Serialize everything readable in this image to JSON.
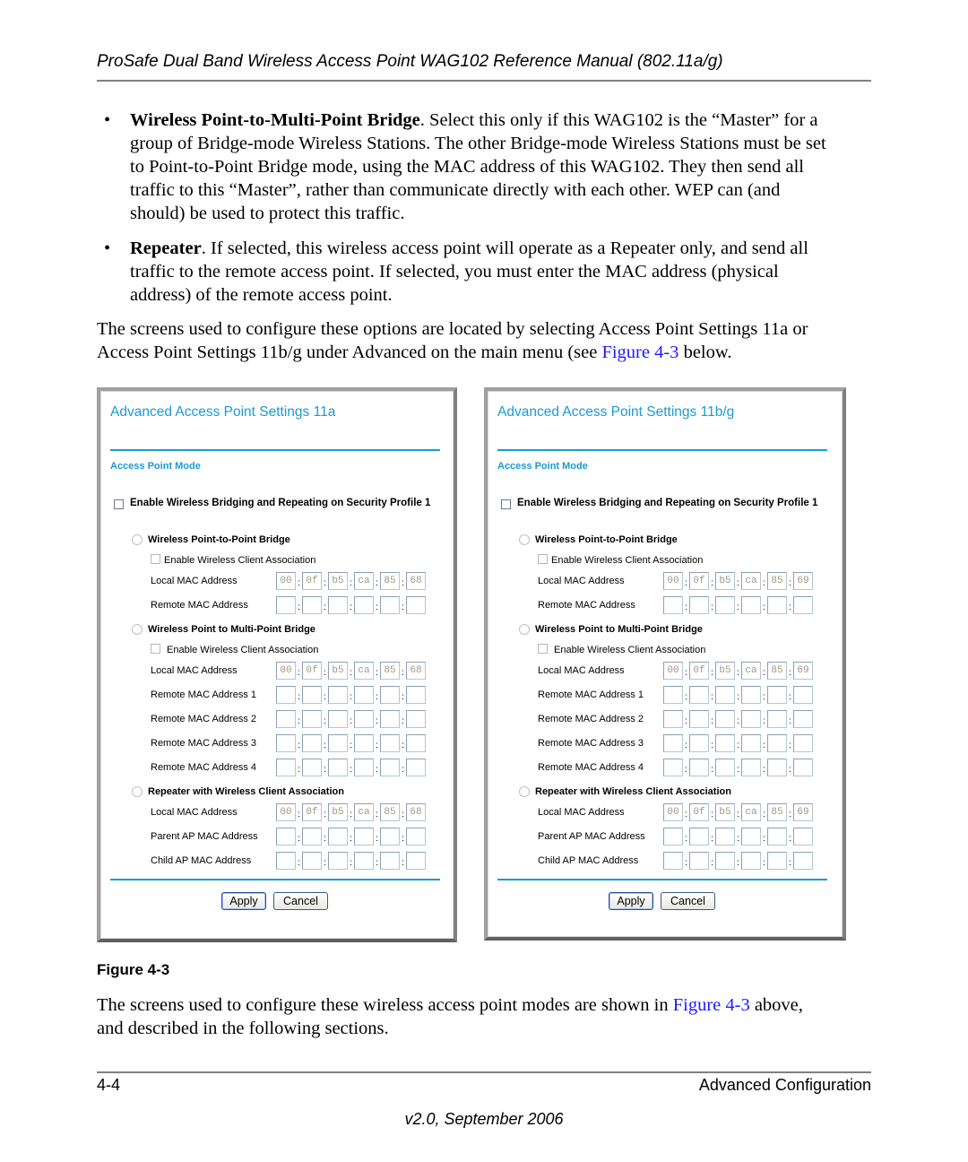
{
  "header": {
    "title": "ProSafe Dual Band Wireless Access Point WAG102 Reference Manual (802.11a/g)"
  },
  "bullets": [
    {
      "symbol": "•",
      "term": "Wireless Point-to-Multi-Point Bridge",
      "lines": [
        ". Select this only if this WAG102 is the “Master” for a",
        "group of Bridge-mode Wireless Stations. The other Bridge-mode Wireless Stations must be set",
        "to Point-to-Point Bridge mode, using the MAC address of this WAG102. They then send all",
        "traffic to this “Master”, rather than communicate directly with each other. WEP can (and",
        "should) be used to protect this traffic."
      ]
    },
    {
      "symbol": "•",
      "term": "Repeater",
      "lines": [
        ". If selected, this wireless access point will operate as a Repeater only, and send all",
        "traffic to the remote access point. If selected, you must enter the MAC address (physical",
        "address) of the remote access point."
      ]
    }
  ],
  "intro_para": {
    "line1": "The screens used to configure these options are located by selecting Access Point Settings 11a or",
    "line2_pre": "Access Point Settings 11b/g under Advanced on the main menu (see ",
    "line2_link": "Figure 4-3",
    "line2_post": " below."
  },
  "panels": [
    {
      "title": "Advanced Access Point Settings 11a",
      "subtitle": "Access Point Mode",
      "enable_checkbox": "Enable Wireless Bridging and Repeating on Security Profile 1",
      "p2p": {
        "label": "Wireless Point-to-Point Bridge",
        "client_assoc": "Enable Wireless Client Association",
        "local_label": "Local MAC Address",
        "local_mac": [
          "00",
          "0f",
          "b5",
          "ca",
          "85",
          "68"
        ],
        "remote_label": "Remote MAC Address"
      },
      "p2mp": {
        "label": "Wireless Point to Multi-Point Bridge",
        "client_assoc": "Enable Wireless Client Association",
        "local_label": "Local MAC Address",
        "local_mac": [
          "00",
          "0f",
          "b5",
          "ca",
          "85",
          "68"
        ],
        "remote_labels": [
          "Remote MAC Address 1",
          "Remote MAC Address 2",
          "Remote MAC Address 3",
          "Remote MAC Address 4"
        ]
      },
      "repeater": {
        "label": "Repeater with Wireless Client Association",
        "local_label": "Local MAC Address",
        "local_mac": [
          "00",
          "0f",
          "b5",
          "ca",
          "85",
          "68"
        ],
        "parent_label": "Parent AP MAC Address",
        "child_label": "Child AP MAC Address"
      },
      "apply": "Apply",
      "cancel": "Cancel"
    },
    {
      "title": "Advanced Access Point Settings 11b/g",
      "subtitle": "Access Point Mode",
      "enable_checkbox": "Enable Wireless Bridging and Repeating on Security Profile 1",
      "p2p": {
        "label": "Wireless Point-to-Point Bridge",
        "client_assoc": "Enable Wireless Client Association",
        "local_label": "Local MAC Address",
        "local_mac": [
          "00",
          "0f",
          "b5",
          "ca",
          "85",
          "69"
        ],
        "remote_label": "Remote MAC Address"
      },
      "p2mp": {
        "label": "Wireless Point to Multi-Point Bridge",
        "client_assoc": "Enable Wireless Client Association",
        "local_label": "Local MAC Address",
        "local_mac": [
          "00",
          "0f",
          "b5",
          "ca",
          "85",
          "69"
        ],
        "remote_labels": [
          "Remote MAC Address 1",
          "Remote MAC Address 2",
          "Remote MAC Address 3",
          "Remote MAC Address 4"
        ]
      },
      "repeater": {
        "label": "Repeater with Wireless Client Association",
        "local_label": "Local MAC Address",
        "local_mac": [
          "00",
          "0f",
          "b5",
          "ca",
          "85",
          "69"
        ],
        "parent_label": "Parent AP MAC Address",
        "child_label": "Child AP MAC Address"
      },
      "apply": "Apply",
      "cancel": "Cancel"
    }
  ],
  "figure_caption": "Figure 4-3",
  "closing_para": {
    "line1_pre": "The screens used to configure these wireless access point modes are shown in ",
    "line1_link": "Figure 4-3",
    "line1_post": " above,",
    "line2": "and described in the following sections."
  },
  "footer": {
    "page_number": "4-4",
    "section": "Advanced Configuration",
    "version": "v2.0, September 2006"
  },
  "colors": {
    "accent": "#1a9ad6",
    "link": "#1a1aff"
  }
}
